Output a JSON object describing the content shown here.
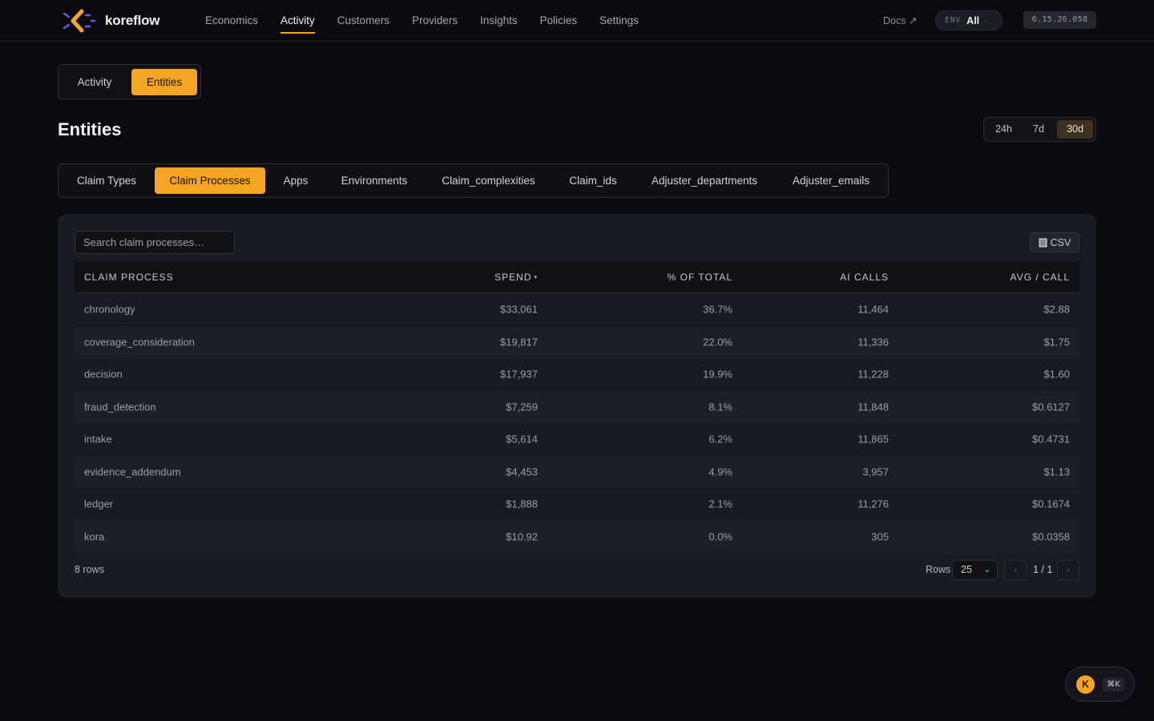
{
  "app": {
    "name": "koreflow",
    "accent": "#f5a524"
  },
  "nav": {
    "items": [
      {
        "label": "Economics",
        "active": false
      },
      {
        "label": "Activity",
        "active": true
      },
      {
        "label": "Customers",
        "active": false
      },
      {
        "label": "Providers",
        "active": false
      },
      {
        "label": "Insights",
        "active": false
      },
      {
        "label": "Policies",
        "active": false
      },
      {
        "label": "Settings",
        "active": false
      }
    ],
    "docs": "Docs ↗",
    "env_label": "ENV",
    "env_value": "All",
    "env_chevron": "·",
    "version": "6.15.26.058"
  },
  "view_toggle": {
    "options": [
      "Activity",
      "Entities"
    ],
    "selected": "Entities"
  },
  "page": {
    "title": "Entities"
  },
  "range": {
    "options": [
      "24h",
      "7d",
      "30d"
    ],
    "selected": "30d"
  },
  "entity_tabs": {
    "items": [
      "Claim Types",
      "Claim Processes",
      "Apps",
      "Environments",
      "Claim_complexities",
      "Claim_ids",
      "Adjuster_departments",
      "Adjuster_emails"
    ],
    "selected": "Claim Processes"
  },
  "table": {
    "search_placeholder": "Search claim processes…",
    "csv_label": "CSV",
    "columns": {
      "process": "CLAIM PROCESS",
      "spend": "SPEND",
      "sort_indicator": "▾",
      "pct": "% OF TOTAL",
      "calls": "AI CALLS",
      "avg": "AVG / CALL"
    },
    "rows": [
      {
        "process": "chronology",
        "spend": "$33,061",
        "pct": "36.7%",
        "calls": "11,464",
        "avg": "$2.88"
      },
      {
        "process": "coverage_consideration",
        "spend": "$19,817",
        "pct": "22.0%",
        "calls": "11,336",
        "avg": "$1.75"
      },
      {
        "process": "decision",
        "spend": "$17,937",
        "pct": "19.9%",
        "calls": "11,228",
        "avg": "$1.60"
      },
      {
        "process": "fraud_detection",
        "spend": "$7,259",
        "pct": "8.1%",
        "calls": "11,848",
        "avg": "$0.6127"
      },
      {
        "process": "intake",
        "spend": "$5,614",
        "pct": "6.2%",
        "calls": "11,865",
        "avg": "$0.4731"
      },
      {
        "process": "evidence_addendum",
        "spend": "$4,453",
        "pct": "4.9%",
        "calls": "3,957",
        "avg": "$1.13"
      },
      {
        "process": "ledger",
        "spend": "$1,888",
        "pct": "2.1%",
        "calls": "11,276",
        "avg": "$0.1674"
      },
      {
        "process": "kora",
        "spend": "$10.92",
        "pct": "0.0%",
        "calls": "305",
        "avg": "$0.0358"
      }
    ],
    "row_count": "8 rows",
    "rows_label": "Rows",
    "rows_per_page": "25",
    "prev": "‹",
    "next": "›",
    "page_indicator": "1 / 1"
  },
  "assistant": {
    "avatar": "K",
    "shortcut": "⌘K"
  }
}
